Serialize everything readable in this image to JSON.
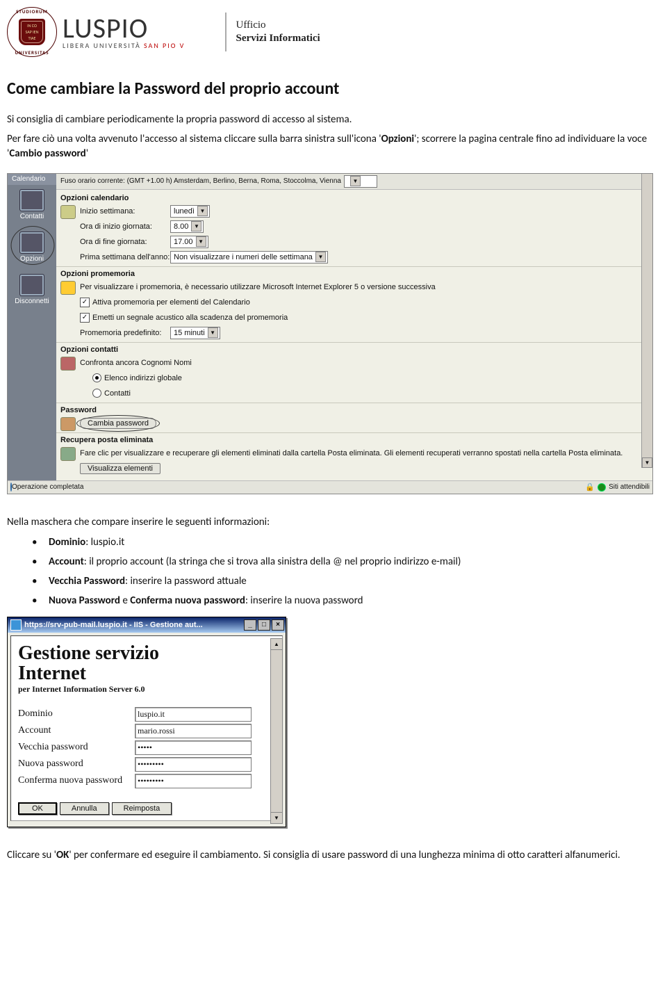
{
  "header": {
    "seal_top": "STUDIORUM",
    "seal_bottom": "UNIVERSITAS",
    "brand": "LUSPIO",
    "brand_sub_pre": "LIBERA UNIVERSITÀ ",
    "brand_sub_red": "SAN PIO V",
    "office_l1": "Ufficio",
    "office_l2": "Servizi Informatici"
  },
  "doc": {
    "title": "Come cambiare la Password del proprio account",
    "p1": "Si consiglia di cambiare periodicamente la propria password di accesso al sistema.",
    "p2_a": "Per fare ciò una volta avvenuto l'accesso al sistema cliccare sulla barra sinistra sull'icona '",
    "p2_b": "Opzioni",
    "p2_c": "'; scorrere la pagina centrale fino ad individuare la voce '",
    "p2_d": "Cambio password",
    "p2_e": "'",
    "p3": "Nella maschera che compare inserire le seguenti informazioni:",
    "b1_a": "Dominio",
    "b1_b": ": luspio.it",
    "b2_a": "Account",
    "b2_b": ": il proprio account (la stringa che si trova alla sinistra della @ nel proprio indirizzo e-mail)",
    "b3_a": "Vecchia Password",
    "b3_b": ": inserire la password attuale",
    "b4_a": "Nuova Password",
    "b4_b": " e ",
    "b4_c": "Conferma nuova password",
    "b4_d": ": inserire la nuova password",
    "p4_a": "Cliccare su '",
    "p4_b": "OK",
    "p4_c": "' per confermare ed eseguire il cambiamento. Si consiglia di usare password di una lunghezza minima di otto caratteri alfanumerici."
  },
  "owa": {
    "topbar": "Fuso orario corrente:     (GMT +1.00 h) Amsterdam, Berlino, Berna, Roma, Stoccolma, Vienna",
    "side_cal": "Calendario",
    "side_contatti": "Contatti",
    "side_opzioni": "Opzioni",
    "side_disc": "Disconnetti",
    "sec_cal": "Opzioni calendario",
    "cal_r1": "Inizio settimana:",
    "cal_r1_v": "lunedì",
    "cal_r2": "Ora di inizio giornata:",
    "cal_r2_v": "8.00",
    "cal_r3": "Ora di fine giornata:",
    "cal_r3_v": "17.00",
    "cal_r4": "Prima settimana dell'anno:",
    "cal_r4_v": "Non visualizzare i numeri delle settimana",
    "sec_prom": "Opzioni promemoria",
    "prom_note": "Per visualizzare i promemoria, è necessario utilizzare Microsoft Internet Explorer 5 o versione successiva",
    "prom_cb1": "Attiva promemoria per elementi del Calendario",
    "prom_cb2": "Emetti un segnale acustico alla scadenza del promemoria",
    "prom_r1": "Promemoria predefinito:",
    "prom_r1_v": "15 minuti",
    "sec_cont": "Opzioni contatti",
    "cont_r1": "Confronta ancora Cognomi Nomi",
    "cont_rb1": "Elenco indirizzi globale",
    "cont_rb2": "Contatti",
    "sec_pwd": "Password",
    "pwd_btn": "Cambia password",
    "sec_rec": "Recupera posta eliminata",
    "rec_note": "Fare clic per visualizzare e recuperare gli elementi eliminati dalla cartella Posta eliminata. Gli elementi recuperati verranno spostati nella cartella Posta eliminata.",
    "rec_btn": "Visualizza elementi",
    "status_l": "Operazione completata",
    "status_r": "Siti attendibili"
  },
  "iis": {
    "title": "https://srv-pub-mail.luspio.it - IIS - Gestione aut...",
    "h1a": "Gestione servizio",
    "h1b": "Internet",
    "sub": "per Internet Information Server 6.0",
    "f1l": "Dominio",
    "f1v": "luspio.it",
    "f2l": "Account",
    "f2v": "mario.rossi",
    "f3l": "Vecchia password",
    "f3v": "•••••",
    "f4l": "Nuova password",
    "f4v": "•••••••••",
    "f5l": "Conferma nuova password",
    "f5v": "•••••••••",
    "b_ok": "OK",
    "b_ann": "Annulla",
    "b_rei": "Reimposta"
  }
}
